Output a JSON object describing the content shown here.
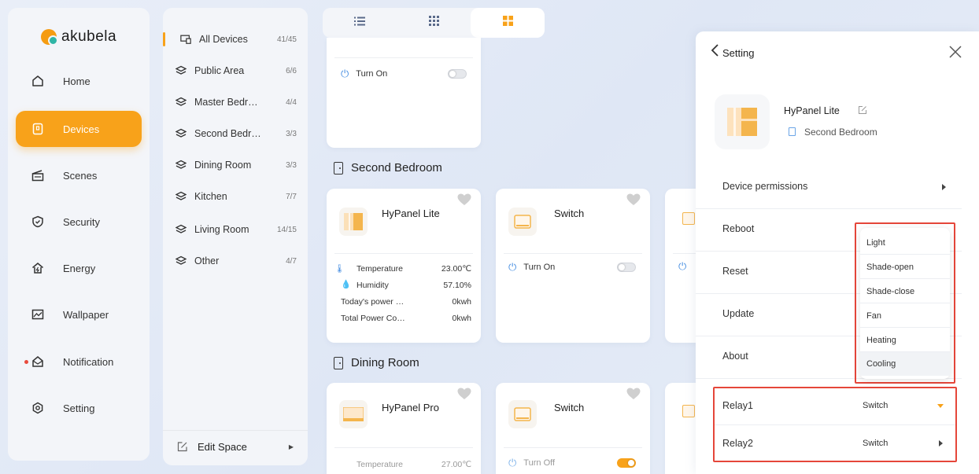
{
  "brand": {
    "name": "akubela"
  },
  "nav": [
    {
      "label": "Home",
      "icon": "home-icon"
    },
    {
      "label": "Devices",
      "icon": "devices-icon",
      "active": true
    },
    {
      "label": "Scenes",
      "icon": "scenes-icon"
    },
    {
      "label": "Security",
      "icon": "shield-icon"
    },
    {
      "label": "Energy",
      "icon": "energy-icon"
    },
    {
      "label": "Wallpaper",
      "icon": "wallpaper-icon"
    },
    {
      "label": "Notification",
      "icon": "notification-icon",
      "has_dot": true
    },
    {
      "label": "Setting",
      "icon": "gear-icon"
    }
  ],
  "rooms": [
    {
      "label": "All Devices",
      "count": "41/45",
      "active": true
    },
    {
      "label": "Public Area",
      "count": "6/6"
    },
    {
      "label": "Master Bedr…",
      "count": "4/4"
    },
    {
      "label": "Second Bedr…",
      "count": "3/3"
    },
    {
      "label": "Dining Room",
      "count": "3/3"
    },
    {
      "label": "Kitchen",
      "count": "7/7"
    },
    {
      "label": "Living Room",
      "count": "14/15"
    },
    {
      "label": "Other",
      "count": "4/7"
    }
  ],
  "edit_space": "Edit Space",
  "view_tabs": [
    "list-view-icon",
    "grid-view-icon",
    "card-view-icon"
  ],
  "top_card": {
    "power_label": "Turn On"
  },
  "sections": {
    "second_bedroom": {
      "title": "Second Bedroom",
      "hypanel": {
        "name": "HyPanel Lite",
        "temperature_label": "Temperature",
        "temperature": "23.00℃",
        "humidity_label": "Humidity",
        "humidity": "57.10%",
        "today_power_label": "Today's power …",
        "today_power": "0kwh",
        "total_power_label": "Total Power Co…",
        "total_power": "0kwh"
      },
      "switch": {
        "name": "Switch",
        "power_label": "Turn On"
      }
    },
    "dining_room": {
      "title": "Dining Room",
      "hypanel": {
        "name": "HyPanel Pro",
        "temperature_label": "Temperature",
        "temperature": "27.00℃"
      },
      "switch": {
        "name": "Switch",
        "power_label": "Turn Off"
      }
    }
  },
  "setting_panel": {
    "title": "Setting",
    "device_name": "HyPanel Lite",
    "device_room": "Second Bedroom",
    "rows": [
      "Device permissions",
      "Reboot",
      "Reset",
      "Update",
      "About"
    ],
    "relays": [
      {
        "label": "Relay1",
        "value": "Switch"
      },
      {
        "label": "Relay2",
        "value": "Switch"
      }
    ],
    "dropdown_options": [
      "Light",
      "Shade-open",
      "Shade-close",
      "Fan",
      "Heating",
      "Cooling"
    ],
    "selected_option": "Cooling"
  },
  "colors": {
    "accent": "#f8a21a",
    "highlight": "#e5463a"
  }
}
